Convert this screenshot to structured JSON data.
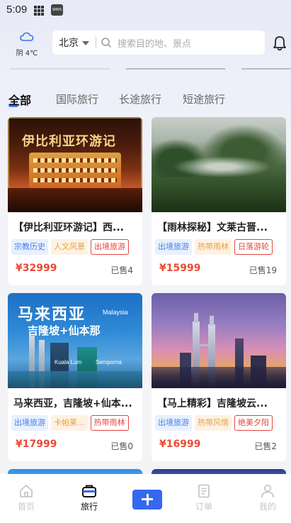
{
  "status": {
    "time": "5:09",
    "app_badge": "WWS"
  },
  "header": {
    "weather": "阴 4℃",
    "city": "北京",
    "search_placeholder": "搜索目的地、景点"
  },
  "tabs": [
    {
      "label": "全部",
      "active": true
    },
    {
      "label": "国际旅行",
      "active": false
    },
    {
      "label": "长途旅行",
      "active": false
    },
    {
      "label": "短途旅行",
      "active": false
    }
  ],
  "cards": [
    {
      "title": "【伊比利亚环游记】西...",
      "image_title": "伊比利亚环游记",
      "tags": [
        {
          "text": "宗教历史",
          "style": "blue"
        },
        {
          "text": "人文风景",
          "style": "orange"
        },
        {
          "text": "出境旅游",
          "style": "red"
        }
      ],
      "price": "¥32999",
      "sold": "已售4"
    },
    {
      "title": "【雨林探秘】文莱古晋...",
      "tags": [
        {
          "text": "出境旅游",
          "style": "blue"
        },
        {
          "text": "热带雨林",
          "style": "orange"
        },
        {
          "text": "日落游轮",
          "style": "red"
        }
      ],
      "price": "¥15999",
      "sold": "已售19"
    },
    {
      "title": "马来西亚，吉隆坡+仙本...",
      "image_title": "马来西亚",
      "image_subtitle": "吉隆坡+仙本那",
      "image_caption_1": "Malaysia",
      "image_caption_2": "Kuala Lum",
      "image_caption_3": "Semporna",
      "tags": [
        {
          "text": "出境旅游",
          "style": "blue"
        },
        {
          "text": "卡帕莱...",
          "style": "orange"
        },
        {
          "text": "热带雨林",
          "style": "red"
        }
      ],
      "price": "¥17999",
      "sold": "已售0"
    },
    {
      "title": "【马上精彩】吉隆坡云...",
      "tags": [
        {
          "text": "出境旅游",
          "style": "blue"
        },
        {
          "text": "热带风情",
          "style": "orange"
        },
        {
          "text": "绝美夕阳",
          "style": "red"
        }
      ],
      "price": "¥16999",
      "sold": "已售2"
    }
  ],
  "nav": [
    {
      "label": "首页",
      "icon": "home-icon"
    },
    {
      "label": "旅行",
      "icon": "briefcase-icon"
    },
    {
      "label": "",
      "icon": "plus-icon"
    },
    {
      "label": "订单",
      "icon": "order-icon"
    },
    {
      "label": "我的",
      "icon": "user-icon"
    }
  ],
  "colors": {
    "accent": "#3568f0",
    "price": "#ea4a35",
    "tag_blue": "#4a7ee8",
    "tag_orange": "#e8a23c",
    "tag_red": "#e6453c"
  }
}
